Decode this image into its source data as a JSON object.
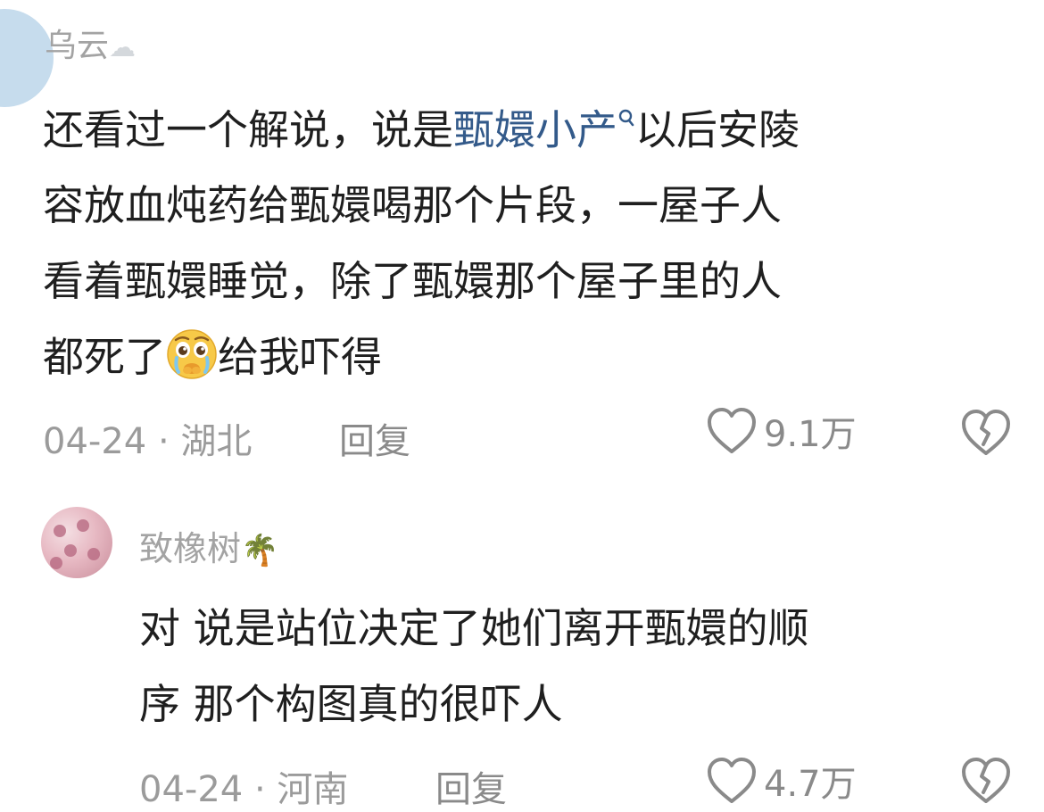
{
  "comments": [
    {
      "username": "乌云",
      "username_emoji": "☁",
      "text_before": "还看过一个解说，说是",
      "link_text": "甄嬛小产",
      "link_icon": "search-icon",
      "text_line1_after": "以后安陵",
      "text_line2": "容放血炖药给甄嬛喝那个片段，一屋子人",
      "text_line3": "看着甄嬛睡觉，除了甄嬛那个屋子里的人",
      "text_line4_before": "都死了",
      "emoji": "pleading-crying-face",
      "text_line4_after": "给我吓得",
      "date_location": "04-24 · 湖北",
      "reply_label": "回复",
      "likes": "9.1万"
    },
    {
      "username": "致橡树",
      "username_emoji": "🌴",
      "text_line1": "对  说是站位决定了她们离开甄嬛的顺",
      "text_line2": "序  那个构图真的很吓人",
      "date_location": "04-24 · 河南",
      "reply_label": "回复",
      "likes": "4.7万"
    }
  ],
  "colors": {
    "link": "#335a8a",
    "meta": "#9b9b9b",
    "text": "#1f1f1f"
  }
}
